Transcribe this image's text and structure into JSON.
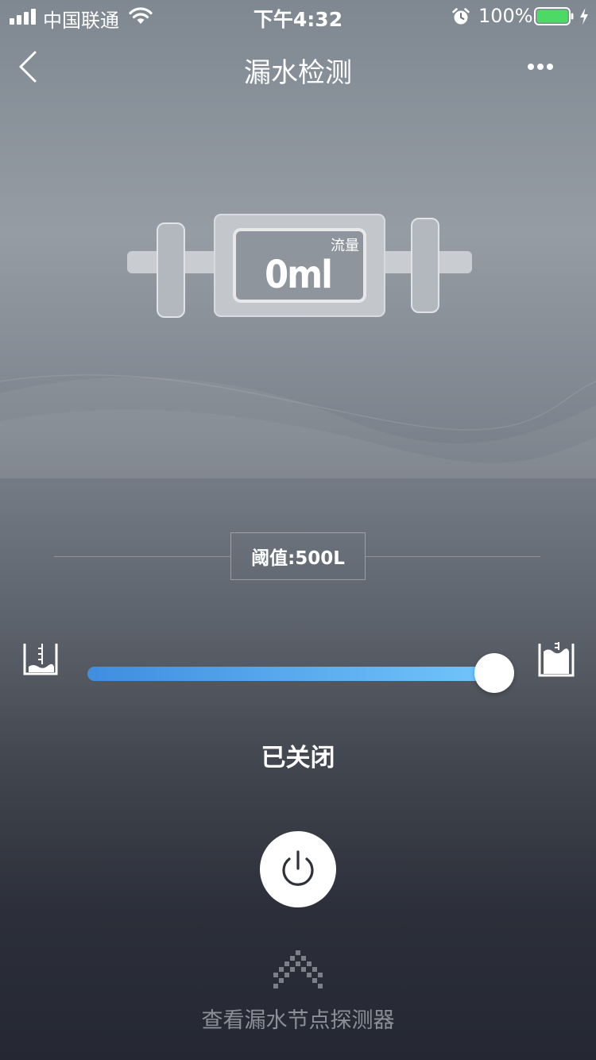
{
  "status_bar": {
    "carrier": "中国联通",
    "time": "下午4:32",
    "battery_percent": "100%",
    "battery_level": 1.0,
    "battery_color": "#4cd964"
  },
  "nav": {
    "title": "漏水检测",
    "back_icon": "chevron-left-icon",
    "more_icon": "more-dots-icon"
  },
  "meter": {
    "label": "流量",
    "value": "0ml"
  },
  "threshold": {
    "label": "阈值:500L"
  },
  "slider": {
    "level": 1.0,
    "track_start_color": "#3f8de0",
    "track_end_color": "#72c7fb",
    "low_icon": "water-low-icon",
    "high_icon": "water-high-icon"
  },
  "state": {
    "text": "已关闭"
  },
  "power": {
    "icon": "power-icon"
  },
  "footer": {
    "icon": "chevron-up-icon",
    "link_text": "查看漏水节点探测器"
  }
}
